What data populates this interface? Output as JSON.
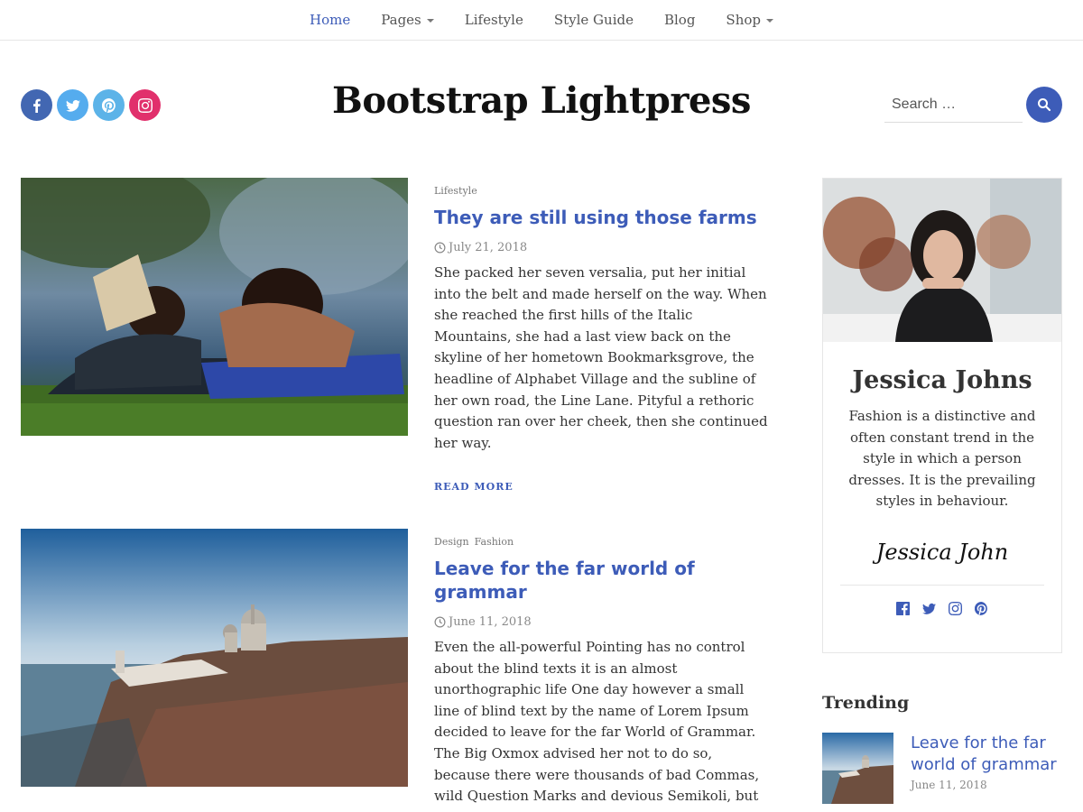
{
  "nav": {
    "items": [
      {
        "label": "Home",
        "active": true,
        "dropdown": false
      },
      {
        "label": "Pages",
        "active": false,
        "dropdown": true
      },
      {
        "label": "Lifestyle",
        "active": false,
        "dropdown": false
      },
      {
        "label": "Style Guide",
        "active": false,
        "dropdown": false
      },
      {
        "label": "Blog",
        "active": false,
        "dropdown": false
      },
      {
        "label": "Shop",
        "active": false,
        "dropdown": true
      }
    ]
  },
  "header": {
    "title": "Bootstrap Lightpress",
    "social": [
      "facebook-icon",
      "twitter-icon",
      "pinterest-icon",
      "instagram-icon"
    ],
    "search_placeholder": "Search …"
  },
  "posts": [
    {
      "categories": [
        "Lifestyle"
      ],
      "title": "They are still using those farms",
      "date": "July 21, 2018",
      "excerpt": "She packed her seven versalia, put her initial into the belt and made herself on the way. When she reached the first hills of the Italic Mountains, she had a last view back on the skyline of her hometown Bookmarksgrove, the headline of Alphabet Village and the subline of her own road, the Line Lane. Pityful a rethoric question ran over her cheek, then she continued her way.",
      "read_more": "READ MORE"
    },
    {
      "categories": [
        "Design",
        "Fashion"
      ],
      "title": "Leave for the far world of grammar",
      "date": "June 11, 2018",
      "excerpt": "Even the all-powerful Pointing has no control about the blind texts it is an almost unorthographic life One day however a small line of blind text by the name of Lorem Ipsum decided to leave for the far World of Grammar. The Big Oxmox advised her not to do so, because there were thousands of bad Commas, wild Question Marks and devious Semikoli, but the Little Blind Text didn’t listen."
    }
  ],
  "sidebar": {
    "about": {
      "name": "Jessica Johns",
      "description": "Fashion is a distinctive and often constant trend in the style in which a person dresses. It is the prevailing styles in behaviour.",
      "signature": "Jessica John",
      "social": [
        "facebook-icon",
        "twitter-icon",
        "instagram-icon",
        "pinterest-icon"
      ]
    },
    "trending": {
      "title": "Trending",
      "items": [
        {
          "title": "Leave for the far world of grammar",
          "date": "June 11, 2018"
        }
      ]
    }
  },
  "colors": {
    "accent": "#3d5cb8",
    "facebook": "#4267b2",
    "twitter": "#55acee",
    "pinterest": "#5cb3e8",
    "instagram": "#e1306c"
  }
}
